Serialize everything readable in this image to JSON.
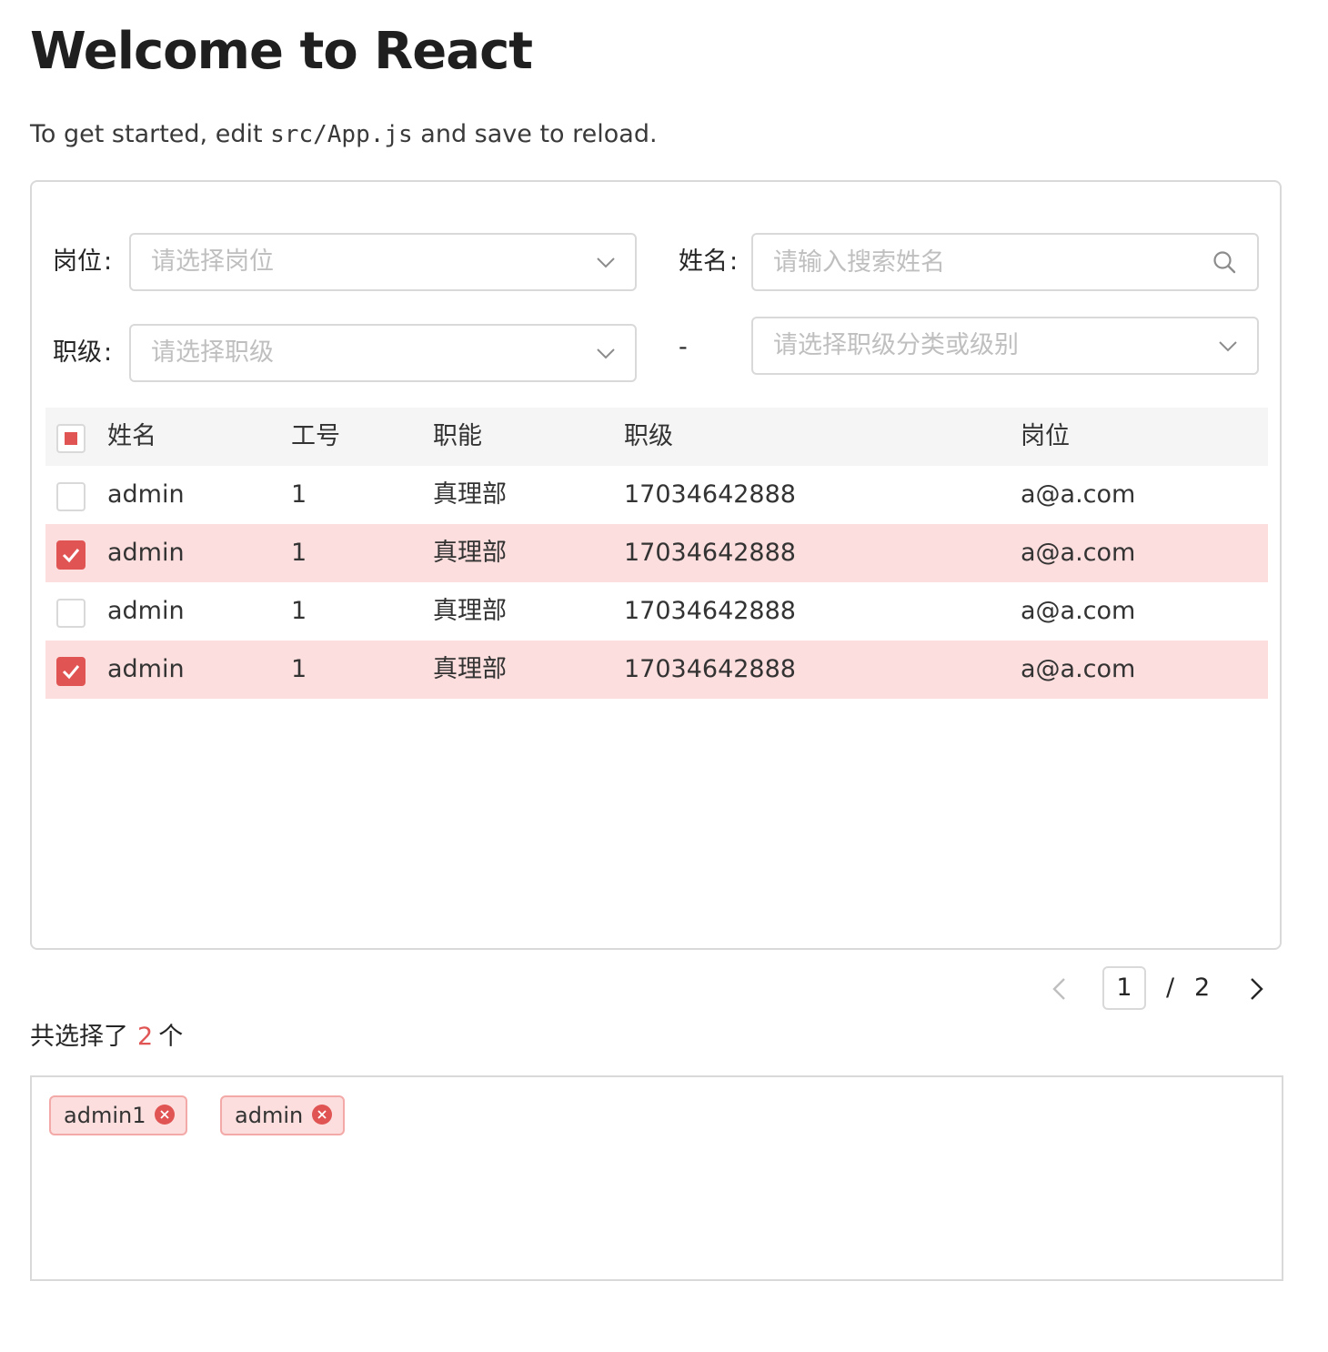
{
  "page": {
    "title": "Welcome to React",
    "intro_before": "To get started, edit ",
    "intro_code": "src/App.js",
    "intro_after": " and save to reload."
  },
  "filters": {
    "position_label": "岗位",
    "position_placeholder": "请选择岗位",
    "name_label": "姓名",
    "name_placeholder": "请输入搜索姓名",
    "level_label": "职级",
    "level_placeholder": "请选择职级",
    "separator": "-",
    "level_category_placeholder": "请选择职级分类或级别",
    "colon": ":"
  },
  "table": {
    "columns": [
      "姓名",
      "工号",
      "职能",
      "职级",
      "岗位"
    ],
    "header_checkbox_state": "indeterminate",
    "rows": [
      {
        "name": "admin",
        "id": "1",
        "function": "真理部",
        "level": "17034642888",
        "position": "a@a.com",
        "selected": false
      },
      {
        "name": "admin",
        "id": "1",
        "function": "真理部",
        "level": "17034642888",
        "position": "a@a.com",
        "selected": true
      },
      {
        "name": "admin",
        "id": "1",
        "function": "真理部",
        "level": "17034642888",
        "position": "a@a.com",
        "selected": false
      },
      {
        "name": "admin",
        "id": "1",
        "function": "真理部",
        "level": "17034642888",
        "position": "a@a.com",
        "selected": true
      }
    ]
  },
  "pagination": {
    "current": "1",
    "separator": "/",
    "total": "2"
  },
  "summary": {
    "prefix": "共选择了",
    "count": "2",
    "suffix": "个"
  },
  "selected_tags": [
    "admin1",
    "admin"
  ],
  "colors": {
    "accent": "#e05453",
    "selected_row_bg": "#fbdedd",
    "header_bg": "#f5f5f5",
    "border": "#d9d9d9",
    "placeholder": "#bfbfbf"
  },
  "icons": {
    "select_arrow": "chevron-down-icon",
    "search": "search-icon",
    "prev": "chevron-left-icon",
    "next": "chevron-right-icon",
    "tag_close": "close-circle-icon",
    "check": "check-icon"
  }
}
